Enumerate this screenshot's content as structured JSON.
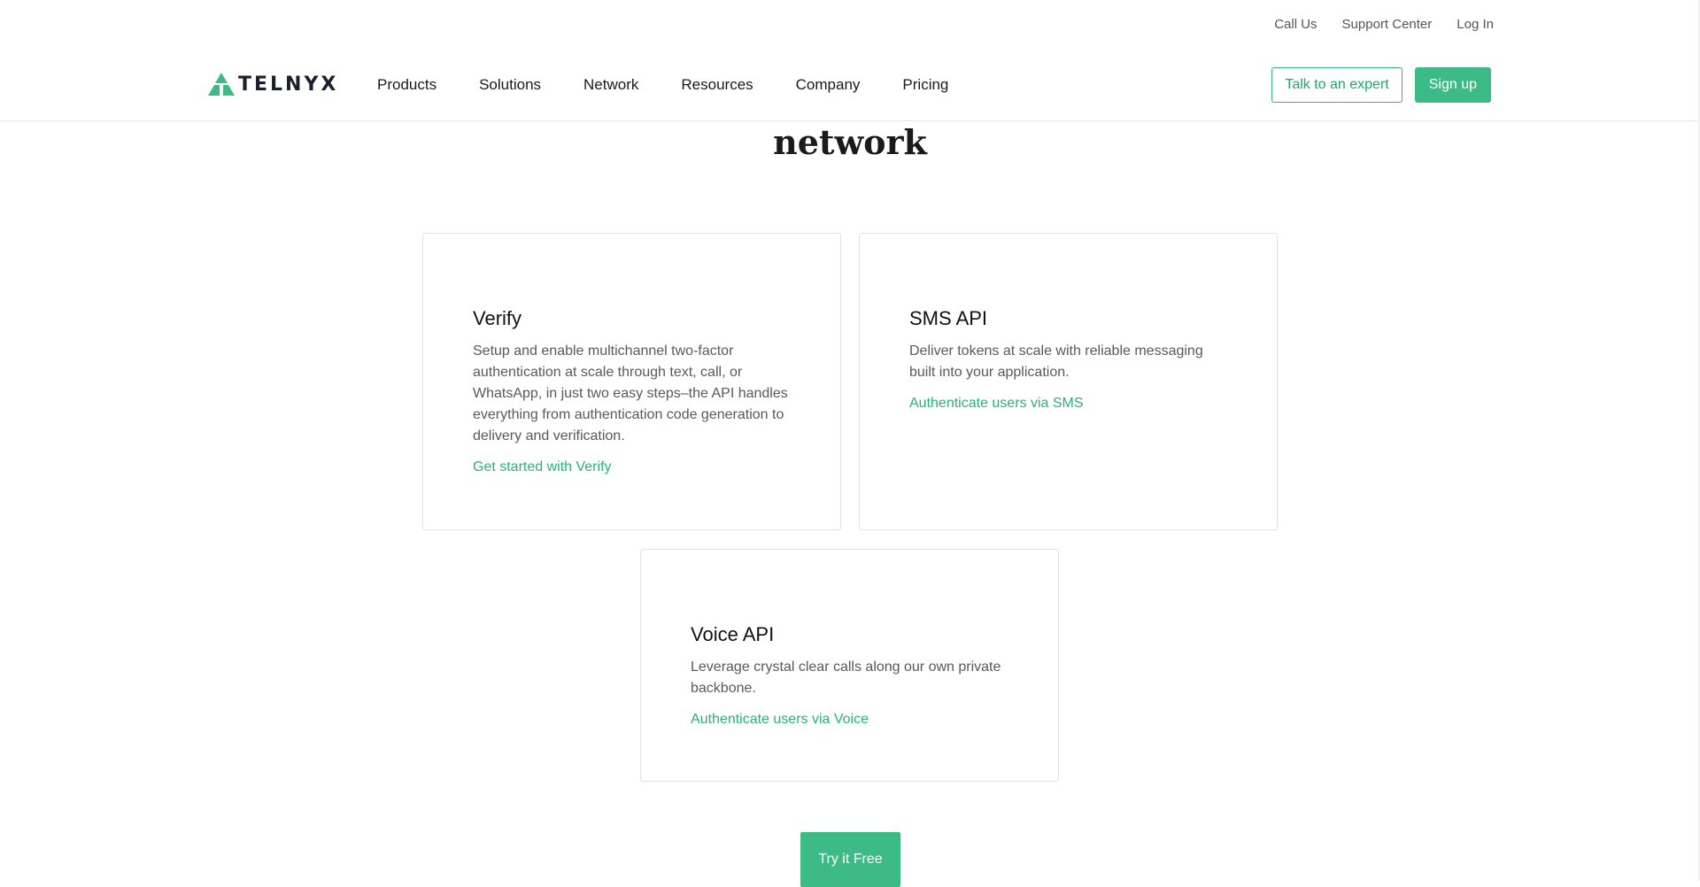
{
  "utility": {
    "call_us": "Call Us",
    "support_center": "Support Center",
    "log_in": "Log In"
  },
  "brand": {
    "name": "TELNYX",
    "accent_color": "#3dbb86"
  },
  "nav": {
    "items": [
      {
        "label": "Products"
      },
      {
        "label": "Solutions"
      },
      {
        "label": "Network"
      },
      {
        "label": "Resources"
      },
      {
        "label": "Company"
      },
      {
        "label": "Pricing"
      }
    ],
    "talk_to_expert": "Talk to an expert",
    "sign_up": "Sign up"
  },
  "heading": "network",
  "cards": [
    {
      "title": "Verify",
      "description": "Setup and enable multichannel two-factor authentication at scale through text, call, or WhatsApp, in just two easy steps–the API handles everything from authentication code generation to delivery and verification.",
      "link": "Get started with Verify"
    },
    {
      "title": "SMS API",
      "description": "Deliver tokens at scale with reliable messaging built into your application.",
      "link": "Authenticate users via SMS"
    },
    {
      "title": "Voice API",
      "description": "Leverage crystal clear calls along our own private backbone.",
      "link": "Authenticate users via Voice"
    }
  ],
  "cta": {
    "try_free": "Try it Free"
  }
}
